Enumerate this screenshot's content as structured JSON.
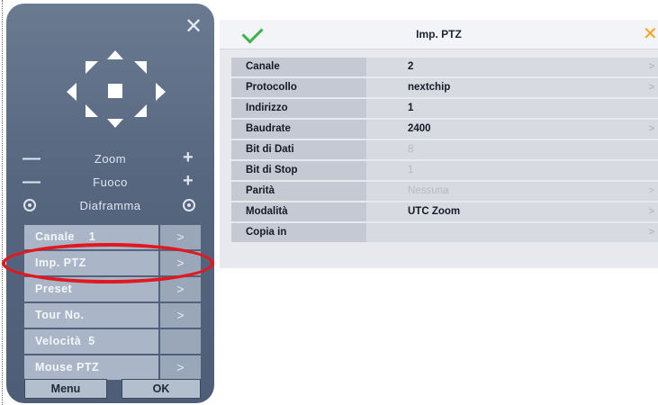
{
  "ptz_panel": {
    "close_icon": "close-icon",
    "zoom_label": "Zoom",
    "focus_label": "Fuoco",
    "iris_label": "Diaframma",
    "minus": "—",
    "plus": "+",
    "menu_items": [
      {
        "label": "Canale    1",
        "arrow": ">"
      },
      {
        "label": "Imp. PTZ",
        "arrow": ">"
      },
      {
        "label": "Preset",
        "arrow": ">"
      },
      {
        "label": "Tour No.",
        "arrow": ">"
      },
      {
        "label": "Velocità  5",
        "arrow": ""
      },
      {
        "label": "Mouse PTZ",
        "arrow": ">"
      }
    ],
    "menu_button": "Menu",
    "ok_button": "OK",
    "highlight_color": "#e01921"
  },
  "settings_panel": {
    "title": "Imp. PTZ",
    "confirm_icon": "check-icon",
    "close_icon": "close-icon",
    "close_glyph": "✕",
    "rows": [
      {
        "key": "Canale",
        "value": "2",
        "arrow": ">"
      },
      {
        "key": "Protocollo",
        "value": "nextchip",
        "arrow": ">"
      },
      {
        "key": "Indirizzo",
        "value": "1",
        "arrow": ""
      },
      {
        "key": "Baudrate",
        "value": "2400",
        "arrow": ">"
      },
      {
        "key": "Bit di Dati",
        "value": "8",
        "arrow": ""
      },
      {
        "key": "Bit di Stop",
        "value": "1",
        "arrow": ""
      },
      {
        "key": "Parità",
        "value": "Nessuna",
        "arrow": ">"
      },
      {
        "key": "Modalità",
        "value": "UTC Zoom",
        "arrow": ">"
      },
      {
        "key": "Copia in",
        "value": "",
        "arrow": ">"
      }
    ],
    "check_color": "#3cb24a",
    "close_color": "#f5a21c"
  }
}
